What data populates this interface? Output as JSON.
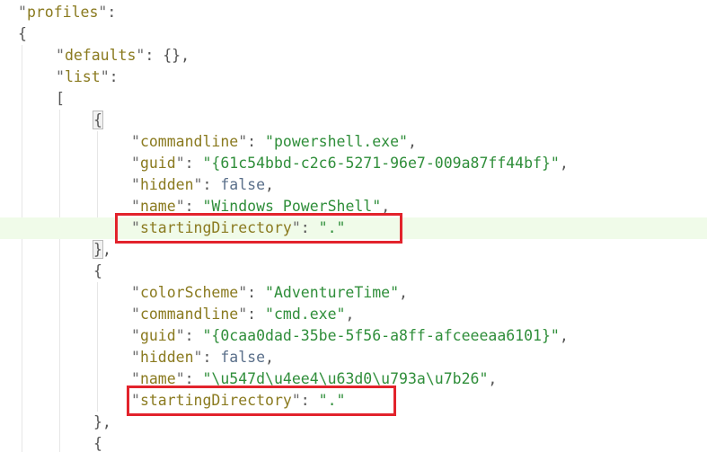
{
  "editor": {
    "lines": [
      {
        "indent": 0,
        "parts": [
          {
            "t": "q",
            "v": "\""
          },
          {
            "t": "key",
            "v": "profiles"
          },
          {
            "t": "q",
            "v": "\""
          },
          {
            "t": "punct",
            "v": ":"
          }
        ]
      },
      {
        "indent": 0,
        "parts": [
          {
            "t": "punct",
            "v": "{"
          }
        ]
      },
      {
        "indent": 1,
        "parts": [
          {
            "t": "q",
            "v": "\""
          },
          {
            "t": "key",
            "v": "defaults"
          },
          {
            "t": "q",
            "v": "\""
          },
          {
            "t": "punct",
            "v": ": {},"
          }
        ]
      },
      {
        "indent": 1,
        "parts": [
          {
            "t": "q",
            "v": "\""
          },
          {
            "t": "key",
            "v": "list"
          },
          {
            "t": "q",
            "v": "\""
          },
          {
            "t": "punct",
            "v": ":"
          }
        ]
      },
      {
        "indent": 1,
        "parts": [
          {
            "t": "punct",
            "v": "["
          }
        ]
      },
      {
        "indent": 2,
        "parts": [
          {
            "t": "bracket",
            "v": "{"
          }
        ]
      },
      {
        "indent": 3,
        "parts": [
          {
            "t": "q",
            "v": "\""
          },
          {
            "t": "key",
            "v": "commandline"
          },
          {
            "t": "q",
            "v": "\""
          },
          {
            "t": "punct",
            "v": ": "
          },
          {
            "t": "str",
            "v": "\"powershell.exe\""
          },
          {
            "t": "punct",
            "v": ","
          }
        ]
      },
      {
        "indent": 3,
        "parts": [
          {
            "t": "q",
            "v": "\""
          },
          {
            "t": "key",
            "v": "guid"
          },
          {
            "t": "q",
            "v": "\""
          },
          {
            "t": "punct",
            "v": ": "
          },
          {
            "t": "str",
            "v": "\"{61c54bbd-c2c6-5271-96e7-009a87ff44bf}\""
          },
          {
            "t": "punct",
            "v": ","
          }
        ]
      },
      {
        "indent": 3,
        "parts": [
          {
            "t": "q",
            "v": "\""
          },
          {
            "t": "key",
            "v": "hidden"
          },
          {
            "t": "q",
            "v": "\""
          },
          {
            "t": "punct",
            "v": ": "
          },
          {
            "t": "kw",
            "v": "false"
          },
          {
            "t": "punct",
            "v": ","
          }
        ]
      },
      {
        "indent": 3,
        "parts": [
          {
            "t": "q",
            "v": "\""
          },
          {
            "t": "key",
            "v": "name"
          },
          {
            "t": "q",
            "v": "\""
          },
          {
            "t": "punct",
            "v": ": "
          },
          {
            "t": "str",
            "v": "\"Windows PowerShell\""
          },
          {
            "t": "punct",
            "v": ","
          }
        ]
      },
      {
        "indent": 3,
        "highlight": true,
        "parts": [
          {
            "t": "q",
            "v": "\""
          },
          {
            "t": "key",
            "v": "startingDirectory"
          },
          {
            "t": "q",
            "v": "\""
          },
          {
            "t": "punct",
            "v": ": "
          },
          {
            "t": "str",
            "v": "\".\""
          }
        ]
      },
      {
        "indent": 2,
        "parts": [
          {
            "t": "bracket",
            "v": "}"
          },
          {
            "t": "punct",
            "v": ","
          }
        ]
      },
      {
        "indent": 2,
        "parts": [
          {
            "t": "punct",
            "v": "{"
          }
        ]
      },
      {
        "indent": 3,
        "parts": [
          {
            "t": "q",
            "v": "\""
          },
          {
            "t": "key",
            "v": "colorScheme"
          },
          {
            "t": "q",
            "v": "\""
          },
          {
            "t": "punct",
            "v": ": "
          },
          {
            "t": "str",
            "v": "\"AdventureTime\""
          },
          {
            "t": "punct",
            "v": ","
          }
        ]
      },
      {
        "indent": 3,
        "parts": [
          {
            "t": "q",
            "v": "\""
          },
          {
            "t": "key",
            "v": "commandline"
          },
          {
            "t": "q",
            "v": "\""
          },
          {
            "t": "punct",
            "v": ": "
          },
          {
            "t": "str",
            "v": "\"cmd.exe\""
          },
          {
            "t": "punct",
            "v": ","
          }
        ]
      },
      {
        "indent": 3,
        "parts": [
          {
            "t": "q",
            "v": "\""
          },
          {
            "t": "key",
            "v": "guid"
          },
          {
            "t": "q",
            "v": "\""
          },
          {
            "t": "punct",
            "v": ": "
          },
          {
            "t": "str",
            "v": "\"{0caa0dad-35be-5f56-a8ff-afceeeaa6101}\""
          },
          {
            "t": "punct",
            "v": ","
          }
        ]
      },
      {
        "indent": 3,
        "parts": [
          {
            "t": "q",
            "v": "\""
          },
          {
            "t": "key",
            "v": "hidden"
          },
          {
            "t": "q",
            "v": "\""
          },
          {
            "t": "punct",
            "v": ": "
          },
          {
            "t": "kw",
            "v": "false"
          },
          {
            "t": "punct",
            "v": ","
          }
        ]
      },
      {
        "indent": 3,
        "parts": [
          {
            "t": "q",
            "v": "\""
          },
          {
            "t": "key",
            "v": "name"
          },
          {
            "t": "q",
            "v": "\""
          },
          {
            "t": "punct",
            "v": ": "
          },
          {
            "t": "str",
            "v": "\"\\u547d\\u4ee4\\u63d0\\u793a\\u7b26\""
          },
          {
            "t": "punct",
            "v": ","
          }
        ]
      },
      {
        "indent": 3,
        "parts": [
          {
            "t": "q",
            "v": "\""
          },
          {
            "t": "key",
            "v": "startingDirectory"
          },
          {
            "t": "q",
            "v": "\""
          },
          {
            "t": "punct",
            "v": ": "
          },
          {
            "t": "str",
            "v": "\".\""
          }
        ]
      },
      {
        "indent": 2,
        "parts": [
          {
            "t": "punct",
            "v": "},"
          }
        ]
      },
      {
        "indent": 2,
        "parts": [
          {
            "t": "punct",
            "v": "{"
          }
        ]
      }
    ],
    "highlight_boxes": [
      {
        "line": 10,
        "color": "#e2232c"
      },
      {
        "line": 18,
        "color": "#e2232c"
      }
    ]
  }
}
